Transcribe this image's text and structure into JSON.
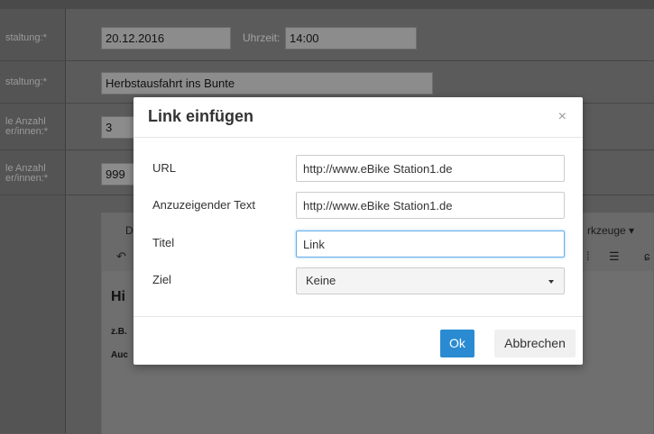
{
  "background_form": {
    "labels": [
      "staltung:*",
      "staltung:*",
      "le Anzahl\ner/innen:*",
      "le Anzahl\ner/innen:*"
    ],
    "date_value": "20.12.2016",
    "time_label": "Uhrzeit:",
    "time_value": "14:00",
    "title_value": "Herbstausfahrt ins Bunte",
    "min_value": "3",
    "max_value": "999"
  },
  "editor": {
    "menu_left": "Dat",
    "menu_right": "rkzeuge ▾",
    "heading_fragment": "Hi",
    "line1_fragment": "z.B.",
    "line2_fragment": "Auc"
  },
  "modal": {
    "title": "Link einfügen",
    "close_symbol": "×",
    "fields": {
      "url_label": "URL",
      "url_value": "http://www.eBike Station1.de",
      "text_label": "Anzuzeigender Text",
      "text_value": "http://www.eBike Station1.de",
      "title_label": "Titel",
      "title_value": "Link",
      "target_label": "Ziel",
      "target_value": "Keine"
    },
    "ok_label": "Ok",
    "cancel_label": "Abbrechen"
  },
  "colors": {
    "primary_button": "#2a8bd2",
    "focus_border": "#66afe9",
    "overlay_dim": "#5b5b5b"
  }
}
